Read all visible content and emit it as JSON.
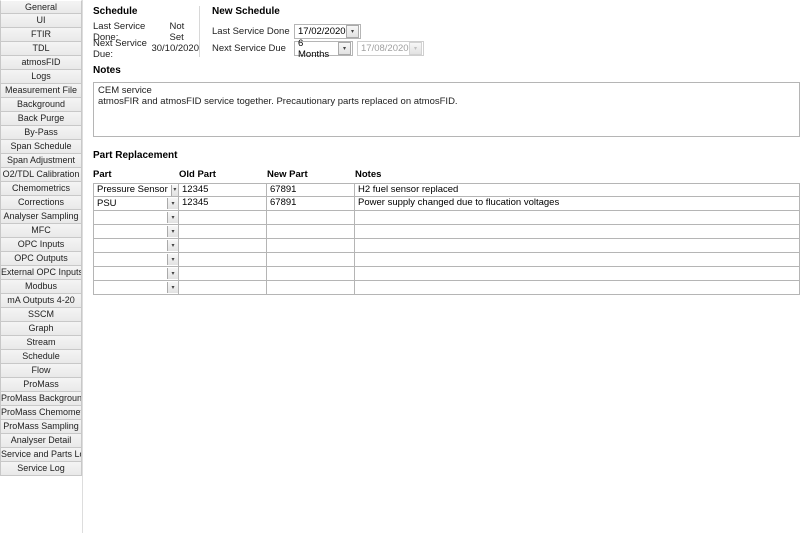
{
  "sidebar": {
    "items": [
      {
        "label": "General"
      },
      {
        "label": "UI"
      },
      {
        "label": "FTIR"
      },
      {
        "label": "TDL"
      },
      {
        "label": "atmosFID"
      },
      {
        "label": "Logs"
      },
      {
        "label": "Measurement File"
      },
      {
        "label": "Background"
      },
      {
        "label": "Back Purge"
      },
      {
        "label": "By-Pass"
      },
      {
        "label": "Span Schedule"
      },
      {
        "label": "Span Adjustment"
      },
      {
        "label": "O2/TDL Calibration"
      },
      {
        "label": "Chemometrics"
      },
      {
        "label": "Corrections"
      },
      {
        "label": "Analyser Sampling"
      },
      {
        "label": "MFC"
      },
      {
        "label": "OPC Inputs"
      },
      {
        "label": "OPC Outputs"
      },
      {
        "label": "External OPC Inputs"
      },
      {
        "label": "Modbus"
      },
      {
        "label": "mA Outputs 4-20"
      },
      {
        "label": "SSCM"
      },
      {
        "label": "Graph"
      },
      {
        "label": "Stream"
      },
      {
        "label": "Schedule"
      },
      {
        "label": "Flow"
      },
      {
        "label": "ProMass"
      },
      {
        "label": "ProMass Background"
      },
      {
        "label": "ProMass Chemometrics"
      },
      {
        "label": "ProMass Sampling"
      },
      {
        "label": "Analyser Detail"
      },
      {
        "label": "Service and Parts Log"
      },
      {
        "label": "Service Log"
      }
    ]
  },
  "schedule": {
    "title": "Schedule",
    "last_done_label": "Last Service Done:",
    "last_done_value": "Not Set",
    "next_due_label": "Next Service Due:",
    "next_due_value": "30/10/2020"
  },
  "new_schedule": {
    "title": "New Schedule",
    "last_done_label": "Last Service Done",
    "last_done_value": "17/02/2020",
    "next_due_label": "Next Service Due",
    "interval_value": "6 Months",
    "next_due_date": "17/08/2020"
  },
  "notes": {
    "title": "Notes",
    "text": "CEM service\natmosFIR and atmosFID service together. Precautionary parts replaced on atmosFID."
  },
  "parts": {
    "title": "Part Replacement",
    "headers": {
      "part": "Part",
      "old": "Old Part",
      "newp": "New Part",
      "notes": "Notes"
    },
    "rows": [
      {
        "part": "Pressure Sensor",
        "old": "12345",
        "newp": "67891",
        "notes": "H2 fuel sensor replaced"
      },
      {
        "part": "PSU",
        "old": "12345",
        "newp": "67891",
        "notes": "Power supply changed due to flucation voltages"
      },
      {
        "part": "",
        "old": "",
        "newp": "",
        "notes": ""
      },
      {
        "part": "",
        "old": "",
        "newp": "",
        "notes": ""
      },
      {
        "part": "",
        "old": "",
        "newp": "",
        "notes": ""
      },
      {
        "part": "",
        "old": "",
        "newp": "",
        "notes": ""
      },
      {
        "part": "",
        "old": "",
        "newp": "",
        "notes": ""
      },
      {
        "part": "",
        "old": "",
        "newp": "",
        "notes": ""
      }
    ]
  }
}
